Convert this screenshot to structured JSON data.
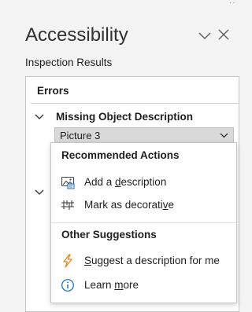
{
  "pane": {
    "title": "Accessibility",
    "subtitle": "Inspection Results"
  },
  "results": {
    "errors_header": "Errors",
    "issue_title": "Missing Object Description",
    "object_name": "Picture 3"
  },
  "menu": {
    "recommended_header": "Recommended Actions",
    "recommended": [
      {
        "icon": "image-description-icon",
        "pre": "Add a ",
        "key": "d",
        "post": "escription"
      },
      {
        "icon": "decorative-icon",
        "pre": "Mark as decorati",
        "key": "v",
        "post": "e"
      }
    ],
    "other_header": "Other Suggestions",
    "other": [
      {
        "icon": "lightning-icon",
        "pre": "",
        "key": "S",
        "post": "uggest a description for me"
      },
      {
        "icon": "info-icon",
        "pre": "Learn ",
        "key": "m",
        "post": "ore"
      }
    ]
  },
  "colors": {
    "pane_bg": "#f3f3f3",
    "accent_blue": "#0f6cbd",
    "lightning_orange": "#e8830c"
  }
}
